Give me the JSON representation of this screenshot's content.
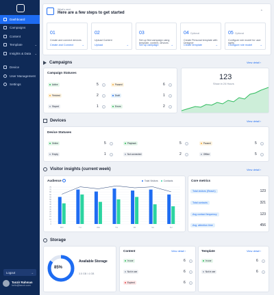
{
  "sidebar": {
    "items": [
      {
        "label": "Dashboard",
        "icon": "grid-icon",
        "active": true
      },
      {
        "label": "Campaigns",
        "icon": "play-icon"
      },
      {
        "label": "Content",
        "icon": "file-icon"
      },
      {
        "label": "Template",
        "icon": "template-icon"
      },
      {
        "label": "Insights & Data",
        "icon": "chart-icon"
      },
      {
        "label": "Device",
        "icon": "monitor-icon"
      },
      {
        "label": "User Management",
        "icon": "user-icon"
      },
      {
        "label": "Settings",
        "icon": "gear-icon"
      }
    ],
    "logout": "Logout",
    "user": {
      "name": "Tanzir Rahman",
      "email": "hello@tanzir.com"
    }
  },
  "steps": {
    "whats_next": "What's next:",
    "title": "Here are a few steps to get started",
    "items": [
      {
        "num": "01",
        "optional": "",
        "desc": "Create and connect devices",
        "link": "Create and Connect"
      },
      {
        "num": "02",
        "optional": "",
        "desc": "Upload Content",
        "link": "Upload"
      },
      {
        "num": "03",
        "optional": "",
        "desc": "Set up first campaign using template, content, devices",
        "link": "Set up campaign"
      },
      {
        "num": "04",
        "optional": "Optional",
        "desc": "Create Personal template with Designer",
        "link": "Create template"
      },
      {
        "num": "05",
        "optional": "Optional",
        "desc": "Configure role model for user rights",
        "link": "Configure role model"
      }
    ]
  },
  "campaigns": {
    "title": "Campaigns",
    "view": "View detail",
    "statuses_title": "Campaign Statuses",
    "statuses": [
      {
        "label": "Active",
        "count": "5",
        "bg": "#e5f6ea",
        "dot": "#2dbb5c"
      },
      {
        "label": "Paused",
        "count": "6",
        "bg": "#fdf3e0",
        "dot": "#f2a93b"
      },
      {
        "label": "Finished",
        "count": "2",
        "bg": "#fdf3e0",
        "dot": "#f2a93b"
      },
      {
        "label": "Draft",
        "count": "1",
        "bg": "#e3f0fb",
        "dot": "#1e6cf2"
      },
      {
        "label": "Stoped",
        "count": "1",
        "bg": "#eef0f3",
        "dot": "#9aa4b5"
      },
      {
        "label": "Errors",
        "count": "2",
        "bg": "#e5f6ea",
        "dot": "#2dbb5c"
      }
    ],
    "show_count": "123",
    "show_sub": "Show in 24 Hours"
  },
  "devices": {
    "title": "Devices",
    "view": "View detail",
    "statuses_title": "Device Statuses",
    "statuses": [
      {
        "label": "Online",
        "count": "5",
        "bg": "#e5f6ea",
        "dot": "#2dbb5c"
      },
      {
        "label": "Playback",
        "count": "5",
        "bg": "#e5f6ea",
        "dot": "#2dbb5c"
      },
      {
        "label": "Paused",
        "count": "5",
        "bg": "#fdf3e0",
        "dot": "#f2a93b"
      },
      {
        "label": "Empty",
        "count": "1",
        "bg": "#eef0f3",
        "dot": "#9aa4b5"
      },
      {
        "label": "Not connected",
        "count": "2",
        "bg": "#eef0f3",
        "dot": "#9aa4b5"
      },
      {
        "label": "Offline",
        "count": "5",
        "bg": "#eef0f3",
        "dot": "#9aa4b5"
      }
    ]
  },
  "visitor": {
    "title": "Visitor insights (current week)",
    "view": "View detail",
    "audience_title": "Audience",
    "legend": [
      "Total Visitors",
      "Contacts"
    ],
    "core_title": "Core metrics",
    "metrics": [
      {
        "label": "Total visitors (Reach)",
        "value": "123"
      },
      {
        "label": "Total contacts",
        "value": "321"
      },
      {
        "label": "Avg contact frequency",
        "value": "123"
      },
      {
        "label": "Avg. attention time",
        "value": "456"
      }
    ]
  },
  "chart_data": {
    "type": "bar",
    "categories": [
      "MO",
      "TU",
      "WE",
      "TH",
      "FR",
      "SA",
      "SU"
    ],
    "series": [
      {
        "name": "Total Visitors",
        "values": [
          55,
          70,
          66,
          72,
          68,
          70,
          60
        ]
      },
      {
        "name": "Contacts",
        "values": [
          42,
          60,
          45,
          50,
          55,
          40,
          36
        ]
      }
    ],
    "yticks": [
      "0",
      "5",
      "10",
      "15",
      "20",
      "25",
      "30",
      "35",
      "40",
      "45",
      "50",
      "55",
      "60",
      "65",
      "70",
      "75"
    ],
    "ylim": [
      0,
      75
    ],
    "colors": {
      "Total Visitors": "#1e6cf2",
      "Contacts": "#2bd4a0"
    }
  },
  "storage": {
    "title": "Storage",
    "percent": "85%",
    "label": "Available Storage",
    "used": "3.5 GB / 4 GB",
    "content": {
      "title": "Content",
      "view": "View detail",
      "rows": [
        {
          "label": "In use",
          "count": "6",
          "bg": "#e5f6ea",
          "dot": "#2dbb5c"
        },
        {
          "label": "Not in use",
          "count": "6",
          "bg": "#eef0f3",
          "dot": "#9aa4b5"
        },
        {
          "label": "Expired",
          "count": "6",
          "bg": "#fde6e6",
          "dot": "#e5484d"
        }
      ]
    },
    "template": {
      "title": "Template",
      "view": "View detail",
      "rows": [
        {
          "label": "In use",
          "count": "6",
          "bg": "#e5f6ea",
          "dot": "#2dbb5c"
        },
        {
          "label": "Not in use",
          "count": "6",
          "bg": "#eef0f3",
          "dot": "#9aa4b5"
        }
      ]
    }
  }
}
